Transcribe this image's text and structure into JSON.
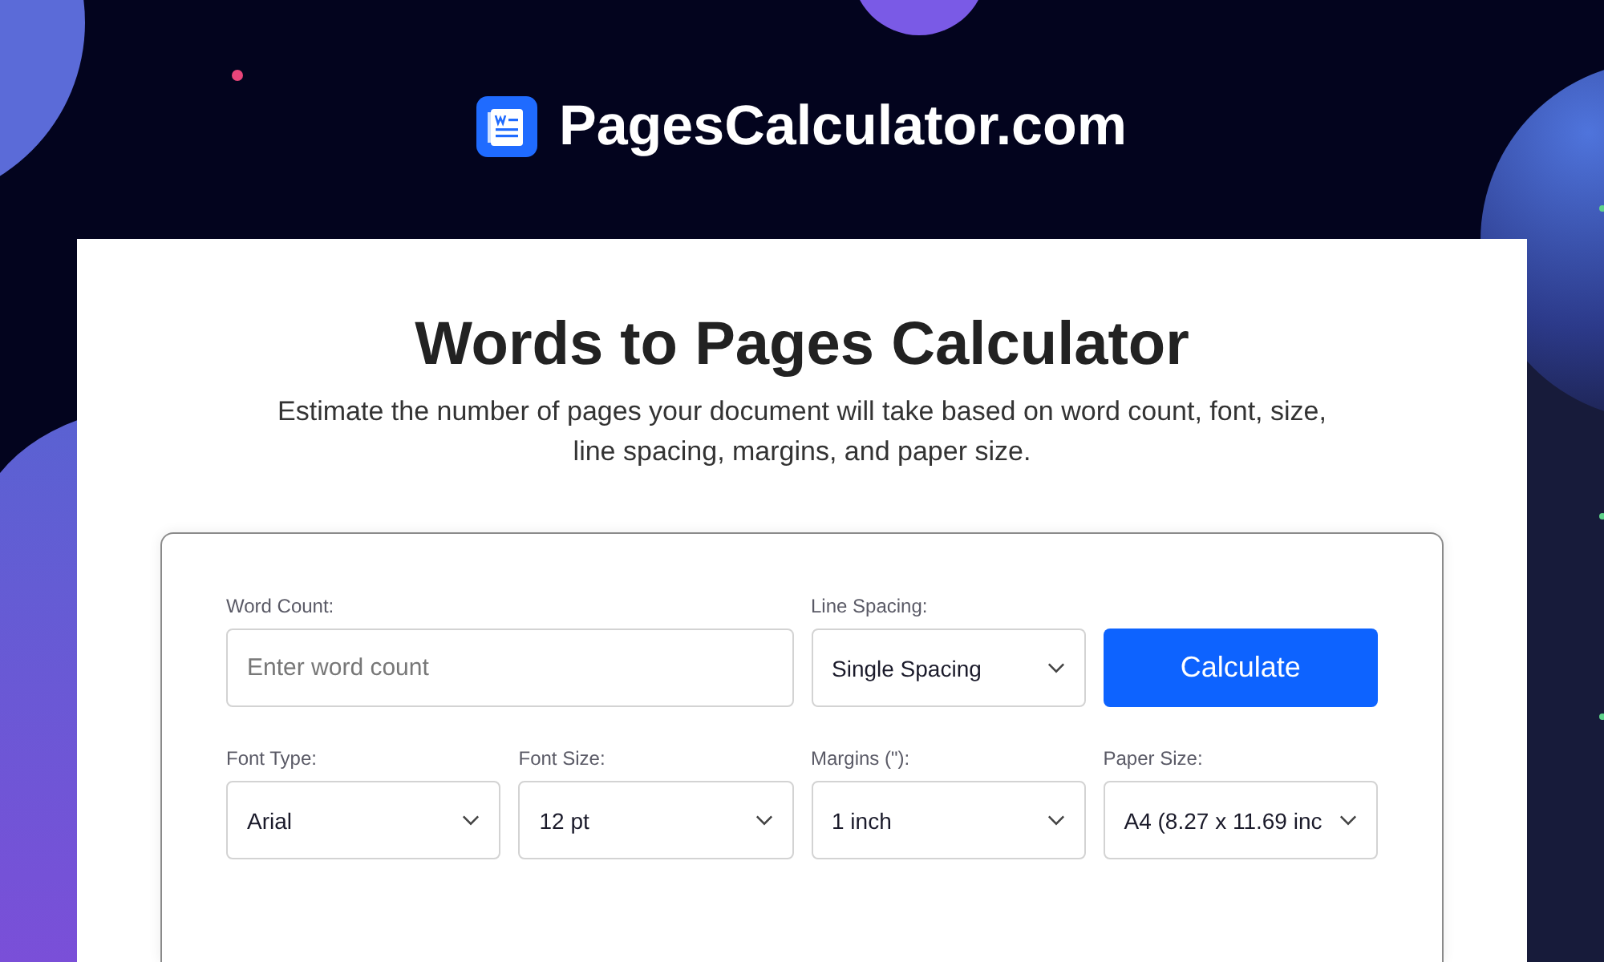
{
  "header": {
    "site_name": "PagesCalculator.com"
  },
  "page": {
    "title": "Words to Pages Calculator",
    "description": "Estimate the number of pages your document will take based on word count, font, size, line spacing, margins, and paper size."
  },
  "form": {
    "fields": [
      {
        "kind": "input",
        "label": "Word Count:",
        "placeholder": "Enter word count"
      },
      {
        "kind": "select",
        "label": "Line Spacing:",
        "value": "Single Spacing"
      },
      {
        "kind": "button",
        "label": "Calculate"
      },
      {
        "kind": "select",
        "label": "Font Type:",
        "value": "Arial"
      },
      {
        "kind": "select",
        "label": "Font Size:",
        "value": "12 pt"
      },
      {
        "kind": "select",
        "label": "Margins (\"):",
        "value": "1 inch"
      },
      {
        "kind": "select",
        "label": "Paper Size:",
        "value": "A4 (8.27 x 11.69 inc"
      }
    ]
  }
}
